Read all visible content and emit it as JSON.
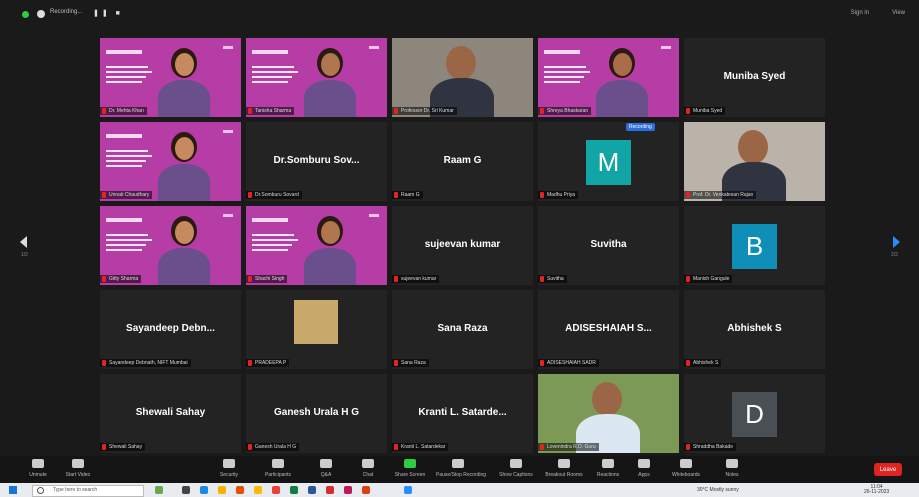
{
  "window": {
    "recording_label": "Recording...",
    "signin_label": "Sign in",
    "view_label": "View",
    "page_left": "1/2",
    "page_right": "2/2"
  },
  "colors": {
    "slide": "#b63da6",
    "active_border": "#c9e04a",
    "mic_off": "#e02424",
    "end": "#e02424"
  },
  "slide_text": {
    "title_line": "Five-Day Faculty Development Programme",
    "subtitle_line": "Design Research Methods"
  },
  "tiles": [
    {
      "name": "Dr. Mehta Khan",
      "kind": "slide",
      "display": ""
    },
    {
      "name": "Tanisha Sharma",
      "kind": "slide",
      "display": ""
    },
    {
      "name": "Professor Dr. Sri Kumar",
      "kind": "video",
      "display": "",
      "active": true
    },
    {
      "name": "Shreya Bhaskaran",
      "kind": "slide",
      "display": ""
    },
    {
      "name": "Muniba Syed",
      "kind": "name",
      "display": "Muniba Syed"
    },
    {
      "name": "Unnati Chaudhary",
      "kind": "slide",
      "display": ""
    },
    {
      "name": "Dr.Somburu Sovard",
      "kind": "name",
      "display": "Dr.Somburu  Sov..."
    },
    {
      "name": "Raam G",
      "kind": "name",
      "display": "Raam G"
    },
    {
      "name": "Madhu Priya",
      "kind": "avatar",
      "display": "M",
      "avatar_color": "#12a5a5"
    },
    {
      "name": "Prof. Dr. Venkatesan Rajan",
      "kind": "video",
      "display": ""
    },
    {
      "name": "Gitty Sharma",
      "kind": "slide",
      "display": ""
    },
    {
      "name": "Shachi Singh",
      "kind": "slide",
      "display": ""
    },
    {
      "name": "sujeevan kumar",
      "kind": "name",
      "display": "sujeevan kumar"
    },
    {
      "name": "Suvitha",
      "kind": "name",
      "display": "Suvitha"
    },
    {
      "name": "Manish Gangule",
      "kind": "avatar",
      "display": "B",
      "avatar_color": "#0f8fb8"
    },
    {
      "name": "Sayandeep Debnath, NIFT Mumbai",
      "kind": "name",
      "display": "Sayandeep  Debn..."
    },
    {
      "name": "PRADEEPA P",
      "kind": "still",
      "display": ""
    },
    {
      "name": "Sana Raza",
      "kind": "name",
      "display": "Sana Raza"
    },
    {
      "name": "ADISESHAIAH SADR",
      "kind": "name",
      "display": "ADISESHAIAH  S..."
    },
    {
      "name": "Abhishek S",
      "kind": "name",
      "display": "Abhishek S"
    },
    {
      "name": "Shewali Sahay",
      "kind": "name",
      "display": "Shewali Sahay"
    },
    {
      "name": "Ganesh Urala H G",
      "kind": "name",
      "display": "Ganesh Urala H G"
    },
    {
      "name": "Kranti L. Satardekar",
      "kind": "name",
      "display": "Kranti L. Satarde..."
    },
    {
      "name": "Lovenindra R.D. Guru",
      "kind": "video",
      "display": ""
    },
    {
      "name": "Shraddha Bakade",
      "kind": "avatar",
      "display": "D",
      "avatar_color": "#4a4f55"
    }
  ],
  "record_badge": "Recording",
  "toolbar": {
    "unmute": "Unmute",
    "start_video": "Start Video",
    "security": "Security",
    "participants": "Participants",
    "participant_count": "52",
    "qa": "Q&A",
    "chat": "Chat",
    "share_screen": "Share Screen",
    "pause_recording": "Pause/Stop Recording",
    "show_captions": "Show Captions",
    "breakout_rooms": "Breakout Rooms",
    "reactions": "Reactions",
    "apps": "Apps",
    "whiteboards": "Whiteboards",
    "notes": "Notes",
    "end": "Leave"
  },
  "taskbar": {
    "search_placeholder": "Type here to search",
    "weather": "30°C  Mostly sunny",
    "time": "11:04",
    "date": "26-11-2023"
  }
}
